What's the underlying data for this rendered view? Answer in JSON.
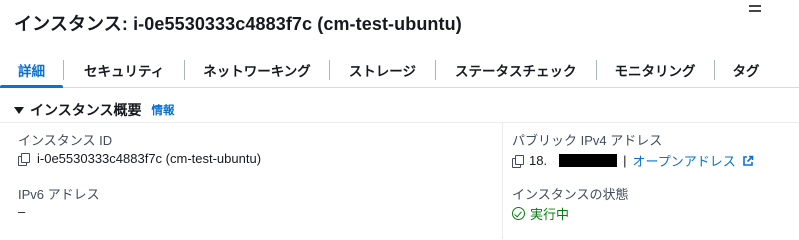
{
  "header": {
    "title": "インスタンス: i-0e5530333c4883f7c (cm-test-ubuntu)"
  },
  "tabs": [
    {
      "label": "詳細",
      "active": true
    },
    {
      "label": "セキュリティ",
      "active": false
    },
    {
      "label": "ネットワーキング",
      "active": false
    },
    {
      "label": "ストレージ",
      "active": false
    },
    {
      "label": "ステータスチェック",
      "active": false
    },
    {
      "label": "モニタリング",
      "active": false
    },
    {
      "label": "タグ",
      "active": false
    }
  ],
  "section": {
    "title": "インスタンス概要",
    "info_link": "情報"
  },
  "fields": {
    "instance_id": {
      "label": "インスタンス ID",
      "value": "i-0e5530333c4883f7c (cm-test-ubuntu)"
    },
    "public_ipv4": {
      "label": "パブリック IPv4 アドレス",
      "value_prefix": "18.",
      "separator": "|",
      "link": "オープンアドレス"
    },
    "ipv6": {
      "label": "IPv6 アドレス",
      "value": "–"
    },
    "instance_state": {
      "label": "インスタンスの状態",
      "value": "実行中"
    }
  },
  "colors": {
    "accent": "#0972d3",
    "success": "#037f0c",
    "text": "#16191f"
  },
  "icons": [
    "menu-icon",
    "caret-down-icon",
    "copy-icon",
    "external-link-icon",
    "status-success-icon"
  ]
}
